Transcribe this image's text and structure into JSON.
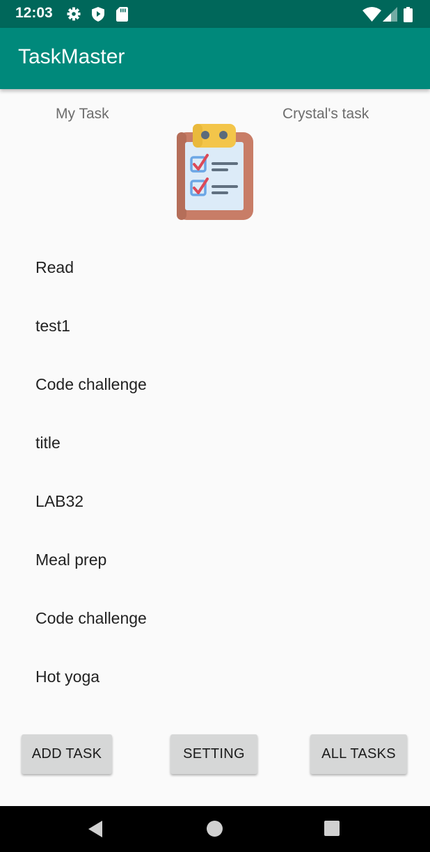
{
  "status_bar": {
    "time": "12:03",
    "left_icons": [
      "gear-icon",
      "shield-icon",
      "sd-card-icon"
    ],
    "right_icons": [
      "wifi-icon",
      "cell-signal-icon",
      "battery-icon"
    ]
  },
  "app_bar": {
    "title": "TaskMaster"
  },
  "header": {
    "left_label": "My Task",
    "right_label": "Crystal's task",
    "logo_icon": "clipboard-checklist-icon"
  },
  "tasks": [
    "Read",
    "test1",
    "Code challenge",
    "title",
    "LAB32",
    "Meal prep",
    "Code challenge",
    "Hot yoga"
  ],
  "buttons": {
    "add_task": "ADD TASK",
    "setting": "SETTING",
    "all_tasks": "ALL TASKS"
  },
  "nav_bar": [
    "back-icon",
    "home-icon",
    "recents-icon"
  ],
  "colors": {
    "status_bar": "#00675a",
    "app_bar": "#00897b",
    "background": "#fafafa",
    "button": "#d6d7d7"
  }
}
